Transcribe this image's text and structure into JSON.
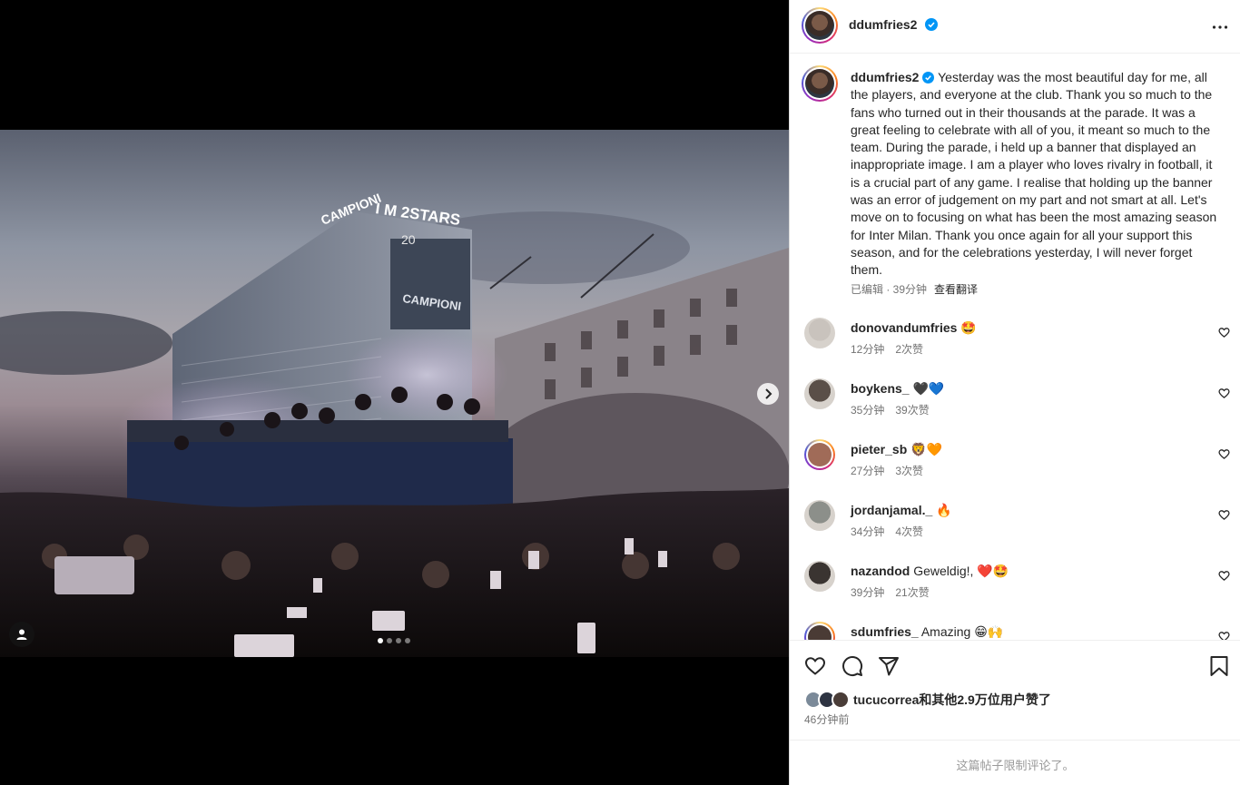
{
  "post": {
    "username": "ddumfries2",
    "caption": "Yesterday was the most beautiful day for me, all the players, and everyone at the club. Thank you so much to the fans who turned out in their thousands at the parade. It was a great feeling to celebrate with all of you, it meant so much to the team. During the parade, i held up a banner that displayed an inappropriate image. I am a player who loves rivalry in football, it is a crucial part of any game. I realise that holding up the banner was an error of judgement on my part and not smart at all. Let's move on to focusing on what has been the most amazing season for Inter Milan. Thank you once again for all your support this season, and for the celebrations yesterday, I will never forget them.",
    "edited": "已编辑 · 39分钟",
    "translate_label": "查看翻译",
    "carousel": {
      "count": 4,
      "active_index": 0
    },
    "photo_text": {
      "sign_top": "I M 2STARS",
      "sign_mid": "CAMPIONI",
      "sign_side": "CAMPIONI",
      "number": "20"
    }
  },
  "comments": [
    {
      "user": "donovandumfries",
      "text": "",
      "emoji": "🤩",
      "time": "12分钟",
      "likes": "2次赞",
      "ring": false,
      "tone": "#c9c3bd"
    },
    {
      "user": "boykens_",
      "text": "",
      "emoji": "🖤💙",
      "time": "35分钟",
      "likes": "39次赞",
      "ring": false,
      "tone": "#5a4f48"
    },
    {
      "user": "pieter_sb",
      "text": "",
      "emoji": "🦁🧡",
      "time": "27分钟",
      "likes": "3次赞",
      "ring": true,
      "tone": "#a06b58"
    },
    {
      "user": "jordanjamal._",
      "text": "",
      "emoji": "🔥",
      "time": "34分钟",
      "likes": "4次赞",
      "ring": false,
      "tone": "#8c8f8a"
    },
    {
      "user": "nazandod",
      "text": "Geweldig!,",
      "emoji": "❤️🤩",
      "time": "39分钟",
      "likes": "21次赞",
      "ring": false,
      "tone": "#3a3431"
    },
    {
      "user": "sdumfries_",
      "text": "Amazing",
      "emoji": "😁🙌",
      "time": "",
      "likes": "",
      "ring": true,
      "tone": "#4a3b35"
    }
  ],
  "likes": {
    "text": "tucucorrea和其他2.9万位用户赞了"
  },
  "time_ago": "46分钟前",
  "limited_comments": "这篇帖子限制评论了。",
  "icons": {
    "verified": "verified-badge-icon",
    "more": "more-options-icon",
    "heart": "heart-icon",
    "comment": "comment-icon",
    "share": "share-icon",
    "save": "bookmark-icon",
    "next": "chevron-right-icon",
    "tag": "user-tag-icon"
  },
  "colors": {
    "verified": "#0095f6",
    "text": "#262626",
    "muted": "#737373"
  }
}
